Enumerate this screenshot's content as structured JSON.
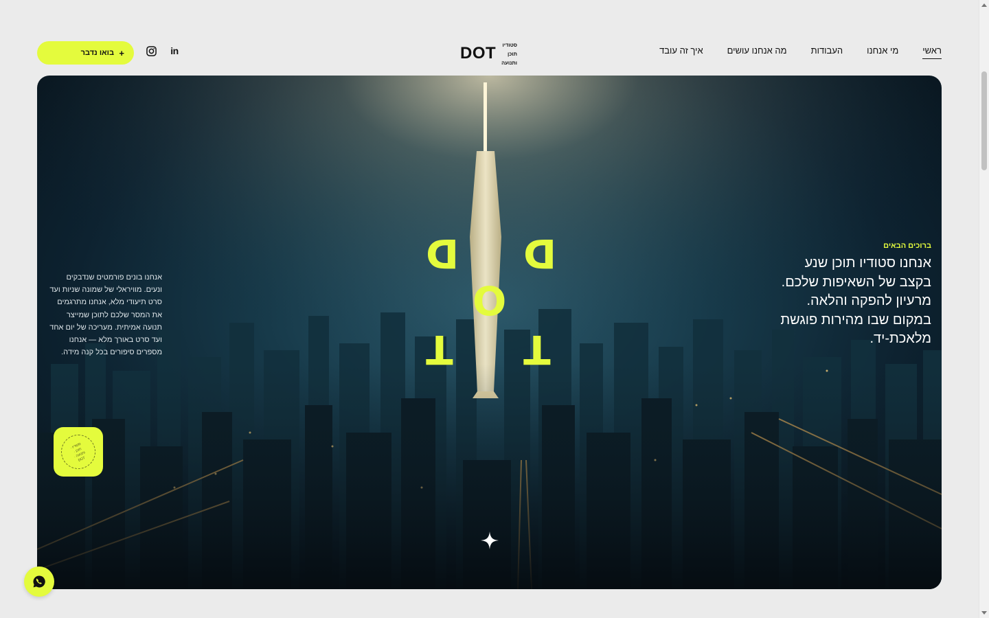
{
  "header": {
    "cta": {
      "label": "בואו נדבר",
      "plus": "+"
    },
    "social": {
      "instagram": "instagram-icon",
      "linkedin": "in"
    },
    "logo": {
      "word": "DOT",
      "tagline": [
        "סטודיו",
        "תוכן",
        "ותנועה"
      ]
    },
    "nav": [
      {
        "label": "ראשי",
        "active": true
      },
      {
        "label": "מי אנחנו",
        "active": false
      },
      {
        "label": "העבודות",
        "active": false
      },
      {
        "label": "מה אנחנו עושים",
        "active": false
      },
      {
        "label": "איך זה עובד",
        "active": false
      }
    ]
  },
  "hero": {
    "kicker": "ברוכים הבאים",
    "headline_lines": [
      "אנחנו סטודיו תוכן שנע",
      "בקצב של השאיפות שלכם.",
      "מרעיון להפקה והלאה.",
      "במקום שבו מהירות פוגשת",
      "מלאכת-יד."
    ],
    "side_text_lines": [
      "אנחנו בונים פורמטים שנדבקים",
      "ונעים. מוויראלי של שמונה שניות ועד",
      "סרט תיעודי מלא, אנחנו מתרגמים",
      "את המסר שלכם לתוכן שמייצר",
      "תנועה אמיתית. מעריכה של יום אחד",
      "ועד סרט באורך מלא — אנחנו",
      "מספרים סיפורים בכל קנה מידה."
    ],
    "letters": {
      "d": "D",
      "o": "O",
      "t": "T"
    },
    "badge_text": "סטודיו · תוכן · ותנועה · DOT",
    "sparkle": "sparkle-icon"
  },
  "whatsapp": {
    "icon": "whatsapp-icon"
  },
  "colors": {
    "accent": "#e4fb3d",
    "background": "#ebebeb",
    "text": "#111111",
    "hero_dark": "#0d2230"
  }
}
